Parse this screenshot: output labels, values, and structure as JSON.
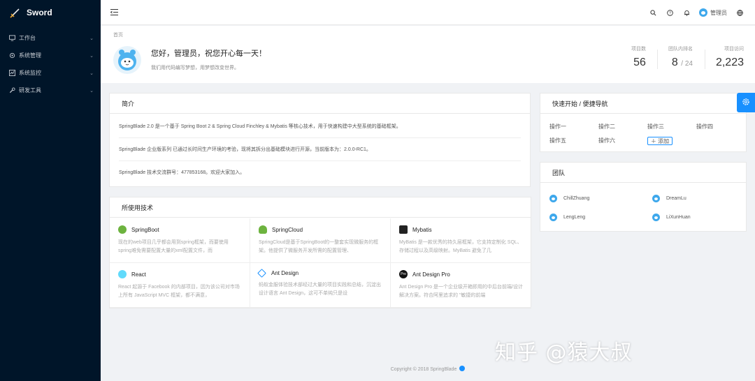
{
  "app": {
    "name": "Sword"
  },
  "sidebar": {
    "items": [
      {
        "label": "工作台",
        "icon": "monitor-icon"
      },
      {
        "label": "系统管理",
        "icon": "gear-icon"
      },
      {
        "label": "系统监控",
        "icon": "chart-icon"
      },
      {
        "label": "研发工具",
        "icon": "wrench-icon"
      }
    ]
  },
  "header": {
    "user_name": "管理员",
    "icons": [
      "menu-fold-icon",
      "search-icon",
      "help-icon",
      "bell-icon",
      "globe-icon"
    ]
  },
  "pagehead": {
    "breadcrumb": "首页",
    "greeting": "您好，管理员，祝您开心每一天！",
    "subtitle": "我们用代码编写梦想，用梦想改变世界。",
    "stats": [
      {
        "label": "项目数",
        "value": "56"
      },
      {
        "label": "团队内排名",
        "value": "8",
        "suffix": "/ 24"
      },
      {
        "label": "项目访问",
        "value": "2,223"
      }
    ]
  },
  "intro": {
    "title": "简介",
    "lines": [
      "SpringBlade 2.0 是一个基于 Spring Boot 2 & Spring Cloud Finchley & Mybatis 等核心技术，用于快速构建中大型系统的基础框架。",
      "SpringBlade 企业版系列 已通过长时间生产环境的考验，现将其拆分出基础模块进行开源，当前版本为：2.0.0-RC1。",
      "SpringBlade 技术交流群号：477853168。欢迎大家加入。"
    ]
  },
  "tech": {
    "title": "所使用技术",
    "items": [
      {
        "name": "SpringBoot",
        "desc": "现在的web项目几乎都会用到spring框架，而要使用spring难免需要配置大量的xml配置文件，而",
        "color": "#6db33f"
      },
      {
        "name": "SpringCloud",
        "desc": "SpringCloud是基于SpringBoot的一整套实现微服务的框架。他提供了微服务开发所需的配置管理、",
        "color": "#6db33f"
      },
      {
        "name": "Mybatis",
        "desc": "MyBatis 是一款优秀的持久层框架，它支持定制化 SQL、存储过程以及高级映射。MyBatis 避免了几",
        "color": "#222222"
      },
      {
        "name": "React",
        "desc": "React 起源于 Facebook 的内部项目，因为该公司对市场上所有 JavaScript MVC 框架，都不满意，",
        "color": "#61dafb"
      },
      {
        "name": "Ant Design",
        "desc": "蚂蚁金服体验技术部经过大量的项目实践和总结，沉淀出设计语言 Ant Design，这可不单纯只是设",
        "color": "#1890ff"
      },
      {
        "name": "Ant Design Pro",
        "desc": "Ant Design Pro 是一个企业级开箱即用的中后台前端/设计解决方案。符合阿里追求的 \"敏捷的前端",
        "color": "#111111",
        "badge": "Pro"
      }
    ]
  },
  "quick": {
    "title": "快速开始 / 便捷导航",
    "ops": [
      "操作一",
      "操作二",
      "操作三",
      "操作四",
      "操作五",
      "操作六"
    ],
    "add_label": "添加"
  },
  "team": {
    "title": "团队",
    "members": [
      "ChillZhuang",
      "DreamLu",
      "LengLeng",
      "LiXunHuan"
    ]
  },
  "footer": {
    "text": "Copyright © 2018 SpringBlade"
  },
  "watermark": {
    "text": "知乎 @猿大叔"
  },
  "colors": {
    "sidebar": "#001529",
    "primary": "#1890ff"
  }
}
